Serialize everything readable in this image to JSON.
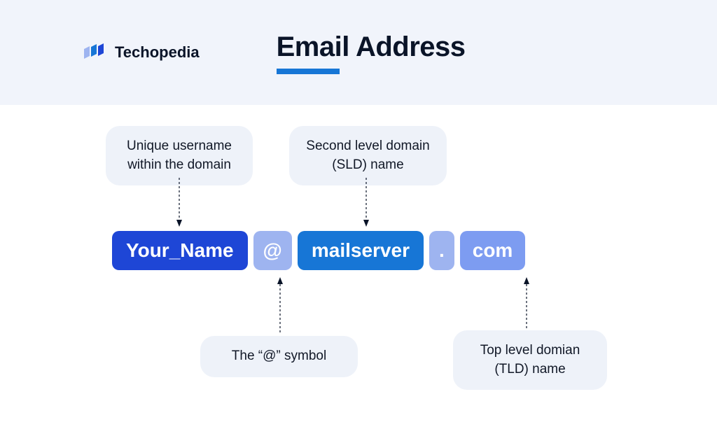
{
  "brand": "Techopedia",
  "title": "Email Address",
  "labels": {
    "username": "Unique username within the domain",
    "sld": "Second level domain (SLD) name",
    "at": "The “@” symbol",
    "tld": "Top level domian (TLD) name"
  },
  "email": {
    "username": "Your_Name",
    "at": "@",
    "server": "mailserver",
    "dot": ".",
    "tld": "com"
  },
  "colors": {
    "header_bg": "#f1f4fb",
    "accent": "#1776d6",
    "pill_user": "#1e46d6",
    "pill_light": "#9eb4f0",
    "pill_server": "#1776d6",
    "pill_tld": "#7d9cf1",
    "label_bg": "#eef2f9"
  }
}
